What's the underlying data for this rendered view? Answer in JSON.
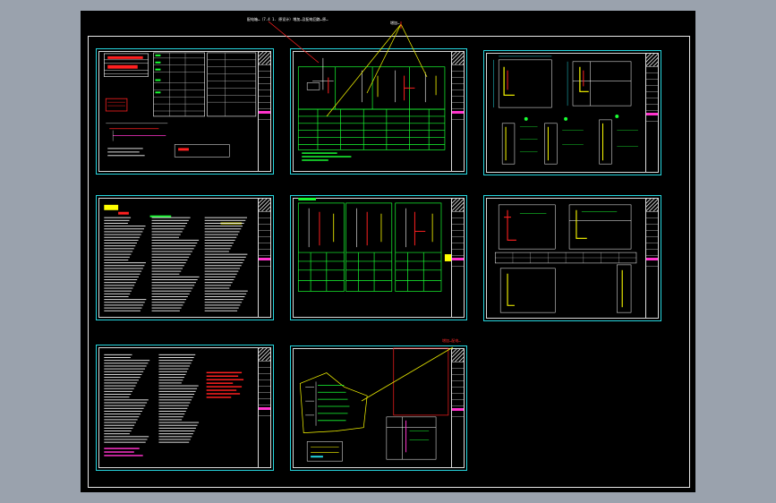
{
  "app": {
    "name": "",
    "background": "#9aa2ad",
    "canvas": "#000000"
  },
  "colors": {
    "sheet_border": "#26d7e0",
    "wire": "#19ff33",
    "accent_red": "#ff2020",
    "accent_yellow": "#ffff00",
    "accent_magenta": "#ff33cc",
    "leader": "#e6e600"
  },
  "sheets": [
    {
      "id": "sheet-1",
      "kind": "legend-and-equipment-tables"
    },
    {
      "id": "sheet-2",
      "kind": "distribution-system-diagram"
    },
    {
      "id": "sheet-3",
      "kind": "floor-plan-and-elevations"
    },
    {
      "id": "sheet-4",
      "kind": "design-notes-text"
    },
    {
      "id": "sheet-5",
      "kind": "panel-schedules"
    },
    {
      "id": "sheet-6",
      "kind": "floor-plan-and-elevations"
    },
    {
      "id": "sheet-7",
      "kind": "design-notes-text"
    },
    {
      "id": "sheet-8",
      "kind": "site-plan-detail"
    }
  ],
  "annotations": {
    "top_callout": "配电箱…（7.4 1. 原设计）增加…及配电回路…原…",
    "top_right_callout": "增加…",
    "bottom_callout": "增加…配电…"
  }
}
